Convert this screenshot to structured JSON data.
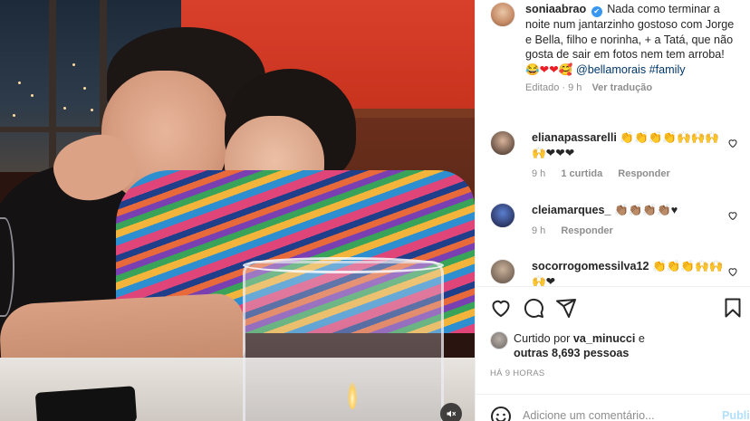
{
  "post": {
    "username": "soniaabrao",
    "verified_mark": "✔",
    "caption": "Nada como terminar a noite num jantarzinho gostoso com Jorge e Bella, filho e norinha, + a Tatá, que não gosta de sair em fotos nem tem arroba!",
    "caption_emoji": "😂❤❤🥰",
    "caption_tags": "@bellamorais #family",
    "status_edited": "Editado · 9 h",
    "see_translation": "Ver tradução"
  },
  "comments": [
    {
      "username": "elianapassarelli",
      "emoji": "👏👏👏👏🙌🙌🙌🙌❤❤❤",
      "time": "9 h",
      "likes": "1 curtida",
      "reply": "Responder"
    },
    {
      "username": "cleiamarques_",
      "emoji": "👏🏽👏🏽👏🏽👏🏽♥",
      "time": "9 h",
      "likes": "",
      "reply": "Responder"
    },
    {
      "username": "socorrogomessilva12",
      "emoji": "👏👏👏🙌🙌🙌❤",
      "time": "",
      "likes": "",
      "reply": ""
    }
  ],
  "likes": {
    "prefix": "Curtido por",
    "user": "va_minucci",
    "and": "e",
    "others": "outras 8,693 pessoas"
  },
  "time_ago": "HÁ 9 HORAS",
  "composer": {
    "placeholder": "Adicione um comentário...",
    "post_label": "Publicar"
  },
  "icons": {
    "like": "heart-icon",
    "comment": "comment-icon",
    "share": "share-icon",
    "save": "bookmark-icon",
    "emoji": "emoji-icon",
    "mute": "speaker-muted-icon"
  },
  "colors": {
    "text": "#262626",
    "muted": "#8e8e8e",
    "link": "#00376b",
    "verified": "#3897f0",
    "post_button": "#b2dffc"
  }
}
